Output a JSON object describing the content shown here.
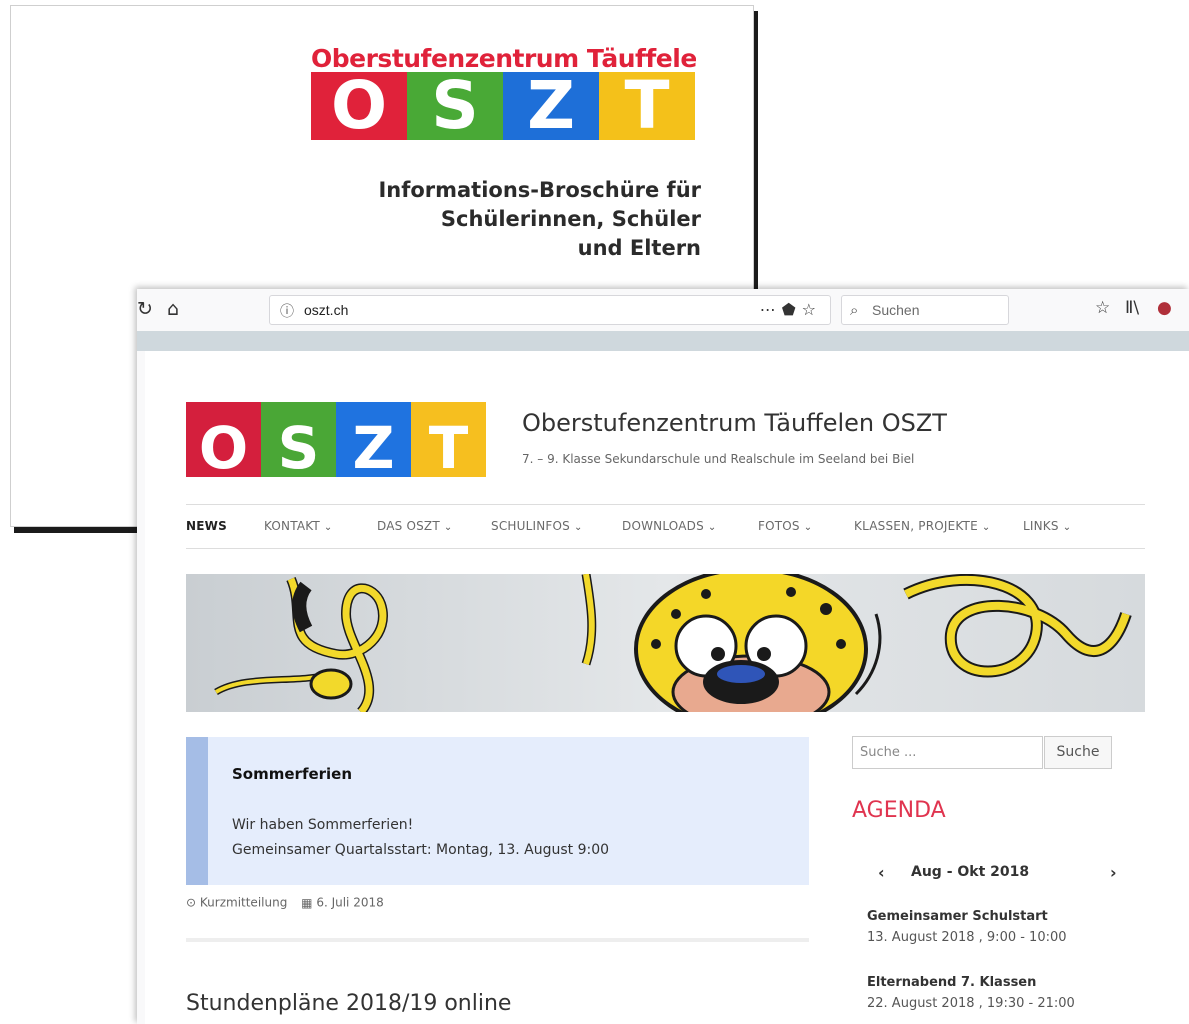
{
  "brochure": {
    "header_line": "Oberstufenzentrum Täuffelen",
    "letters": [
      "O",
      "S",
      "Z",
      "T"
    ],
    "letter_colors": [
      "#e0223a",
      "#49a936",
      "#1e6fd8",
      "#f4c11a"
    ],
    "text_lines": [
      "Informations-Broschüre für",
      "Schülerinnen, Schüler",
      "und Eltern"
    ]
  },
  "browser": {
    "url": "oszt.ch",
    "search_placeholder": "Suchen"
  },
  "site": {
    "logo_letters": [
      "O",
      "S",
      "Z",
      "T"
    ],
    "logo_colors": [
      "#d41f3d",
      "#4aa736",
      "#1f73e0",
      "#f6bf1f"
    ],
    "title": "Oberstufenzentrum Täuffelen OSZT",
    "description": "7. – 9. Klasse Sekundarschule und Realschule im Seeland bei Biel"
  },
  "nav": {
    "items": [
      {
        "label": "NEWS",
        "dropdown": false
      },
      {
        "label": "KONTAKT",
        "dropdown": true
      },
      {
        "label": "DAS OSZT",
        "dropdown": true
      },
      {
        "label": "SCHULINFOS",
        "dropdown": true
      },
      {
        "label": "DOWNLOADS",
        "dropdown": true
      },
      {
        "label": "FOTOS",
        "dropdown": true
      },
      {
        "label": "KLASSEN, PROJEKTE",
        "dropdown": true
      },
      {
        "label": "LINKS",
        "dropdown": true
      }
    ]
  },
  "notice": {
    "title": "Sommerferien",
    "line1": "Wir haben Sommerferien!",
    "line2": "Gemeinsamer Quartalsstart: Montag, 13. August 9:00"
  },
  "post_meta": {
    "category": "Kurzmitteilung",
    "date": "6. Juli 2018"
  },
  "next_post_title": "Stundenpläne 2018/19 online",
  "sidebar": {
    "search_placeholder": "Suche ...",
    "search_button": "Suche",
    "agenda_title": "AGENDA",
    "calendar_range": "Aug - Okt 2018",
    "events": [
      {
        "title": "Gemeinsamer Schulstart",
        "time": "13. August 2018 , 9:00 - 10:00"
      },
      {
        "title": "Elternabend 7. Klassen",
        "time": "22. August 2018 , 19:30 - 21:00"
      }
    ]
  }
}
